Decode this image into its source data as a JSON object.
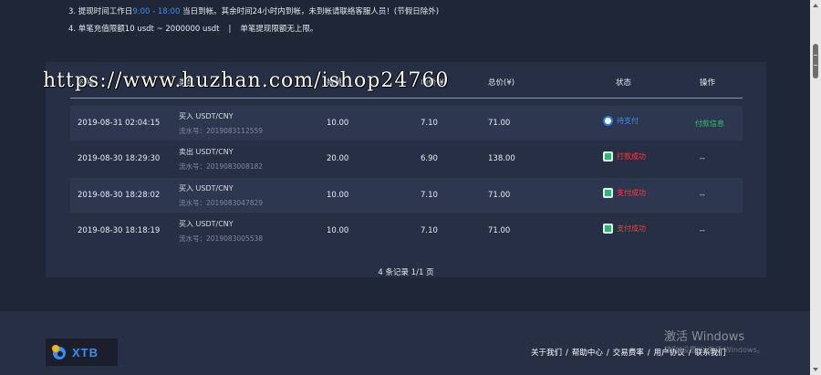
{
  "notes": {
    "line3_prefix": "3. 提现时间工作日",
    "line3_time": "9:00 - 18:00",
    "line3_suffix": " 当日到帐。其余时间24小时内到帐，未到帐请联络客服人员！(节假日除外)",
    "line4_left": "4. 单笔充值限额10 usdt ~ 2000000 usdt",
    "line4_sep": "|",
    "line4_right": "单笔提现限额无上限。"
  },
  "watermark": "https://www.huzhan.com/ishop24760",
  "table": {
    "headers": {
      "time": "时间",
      "type": "类型",
      "qty": "数量",
      "price": "单价(¥)",
      "total": "总价(¥)",
      "status": "状态",
      "action": "操作"
    },
    "rows": [
      {
        "time": "2019-08-31 02:04:15",
        "type": "买入 USDT/CNY",
        "serial": "流水号：2019083112559",
        "qty": "10.00",
        "price": "7.10",
        "total": "71.00",
        "status": "待支付",
        "action": "付款信息"
      },
      {
        "time": "2019-08-30 18:29:30",
        "type": "卖出 USDT/CNY",
        "serial": "流水号：2019083008182",
        "qty": "20.00",
        "price": "6.90",
        "total": "138.00",
        "status": "打款成功",
        "action": "--"
      },
      {
        "time": "2019-08-30 18:28:02",
        "type": "买入 USDT/CNY",
        "serial": "流水号：2019083047829",
        "qty": "10.00",
        "price": "7.10",
        "total": "71.00",
        "status": "支付成功",
        "action": "--"
      },
      {
        "time": "2019-08-30 18:18:19",
        "type": "买入 USDT/CNY",
        "serial": "流水号：2019083005538",
        "qty": "10.00",
        "price": "7.10",
        "total": "71.00",
        "status": "支付成功",
        "action": "--"
      }
    ]
  },
  "pager": "4 条记录 1/1 页",
  "footer": {
    "logo_text": "XTB",
    "links": [
      "关于我们",
      "帮助中心",
      "交易费率",
      "用户协议",
      "联系我们"
    ],
    "separator": "/",
    "activate_title": "激活 Windows",
    "activate_sub": "转到\"设置\"以激活 Windows。"
  },
  "colors": {
    "background": "#1f2637",
    "panel": "#262f44",
    "accent_blue": "#3d8ef0",
    "success_green": "#31c46b",
    "error_red": "#ff3b3b"
  },
  "icons": {
    "pending": "clock-icon",
    "done": "check-box-icon",
    "logo": "xtb-logo-icon"
  }
}
